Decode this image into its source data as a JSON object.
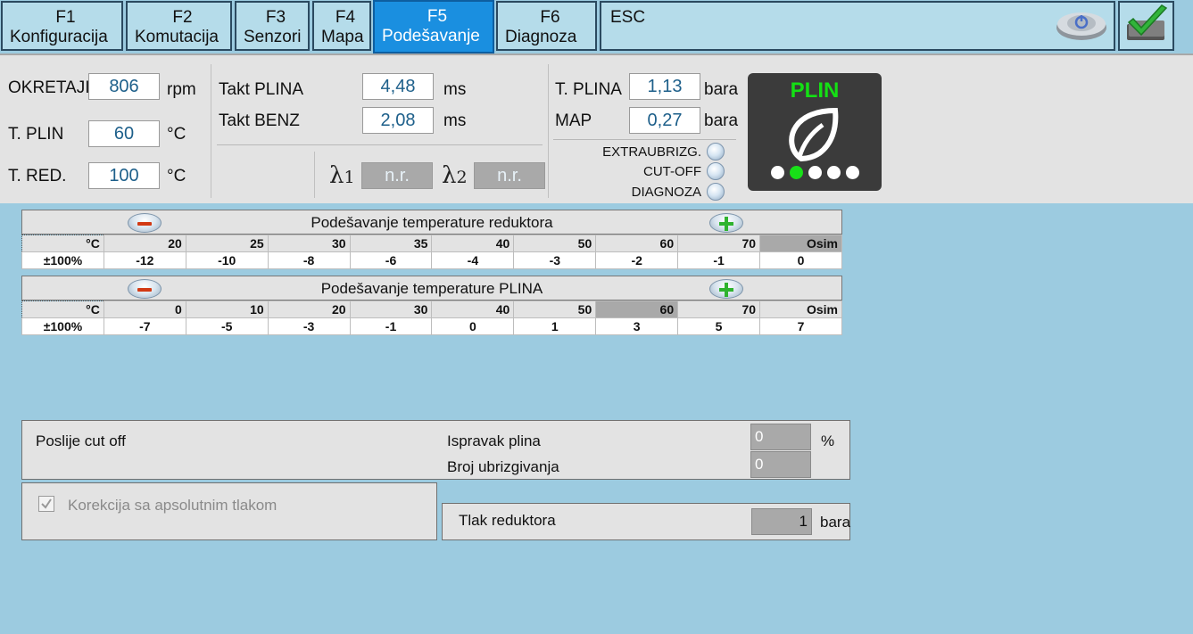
{
  "tabs": [
    {
      "key": "F1",
      "label": "Konfiguracija"
    },
    {
      "key": "F2",
      "label": "Komutacija"
    },
    {
      "key": "F3",
      "label": "Senzori"
    },
    {
      "key": "F4",
      "label": "Mapa"
    },
    {
      "key": "F5",
      "label": "Podešavanje"
    },
    {
      "key": "F6",
      "label": "Diagnoza"
    },
    {
      "key": "ESC",
      "label": ""
    }
  ],
  "status": {
    "okretaji": {
      "label": "OKRETAJI",
      "value": "806",
      "unit": "rpm"
    },
    "t_plin": {
      "label": "T. PLIN",
      "value": "60",
      "unit": "°C"
    },
    "t_red": {
      "label": "T. RED.",
      "value": "100",
      "unit": "°C"
    },
    "takt_plina": {
      "label": "Takt PLINA",
      "value": "4,48",
      "unit": "ms"
    },
    "takt_benz": {
      "label": "Takt BENZ",
      "value": "2,08",
      "unit": "ms"
    },
    "lambda1": {
      "symbol": "λ",
      "index": "1",
      "value": "n.r."
    },
    "lambda2": {
      "symbol": "λ",
      "index": "2",
      "value": "n.r."
    },
    "t_plina": {
      "label": "T. PLINA",
      "value": "1,13",
      "unit": "bara"
    },
    "map": {
      "label": "MAP",
      "value": "0,27",
      "unit": "bara"
    },
    "indicators": [
      "EXTRAUBRIZG.",
      "CUT-OFF",
      "DIAGNOZA"
    ],
    "fuel": {
      "label": "PLIN",
      "level_dots": 5,
      "active_dot": 2
    }
  },
  "table_reduktor": {
    "title": "Podešavanje temperature reduktora",
    "unit_label": "°C",
    "row_label": "±100%",
    "temps": [
      "20",
      "25",
      "30",
      "35",
      "40",
      "50",
      "60",
      "70",
      "Osim"
    ],
    "values": [
      "-12",
      "-10",
      "-8",
      "-6",
      "-4",
      "-3",
      "-2",
      "-1",
      "0"
    ],
    "highlight_col": 8
  },
  "table_plina": {
    "title": "Podešavanje temperature PLINA",
    "unit_label": "°C",
    "row_label": "±100%",
    "temps": [
      "0",
      "10",
      "20",
      "30",
      "40",
      "50",
      "60",
      "70",
      "Osim"
    ],
    "values": [
      "-7",
      "-5",
      "-3",
      "-1",
      "0",
      "1",
      "3",
      "5",
      "7"
    ],
    "highlight_col": 6
  },
  "cutoff": {
    "title": "Poslije cut off",
    "ispravak_label": "Ispravak plina",
    "ispravak_value": "0",
    "ispravak_unit": "%",
    "broj_label": "Broj ubrizgivanja",
    "broj_value": "0"
  },
  "korekcija": {
    "label": "Korekcija sa apsolutnim tlakom",
    "checked": true
  },
  "tlak": {
    "label": "Tlak reduktora",
    "value": "1",
    "unit": "bara"
  }
}
